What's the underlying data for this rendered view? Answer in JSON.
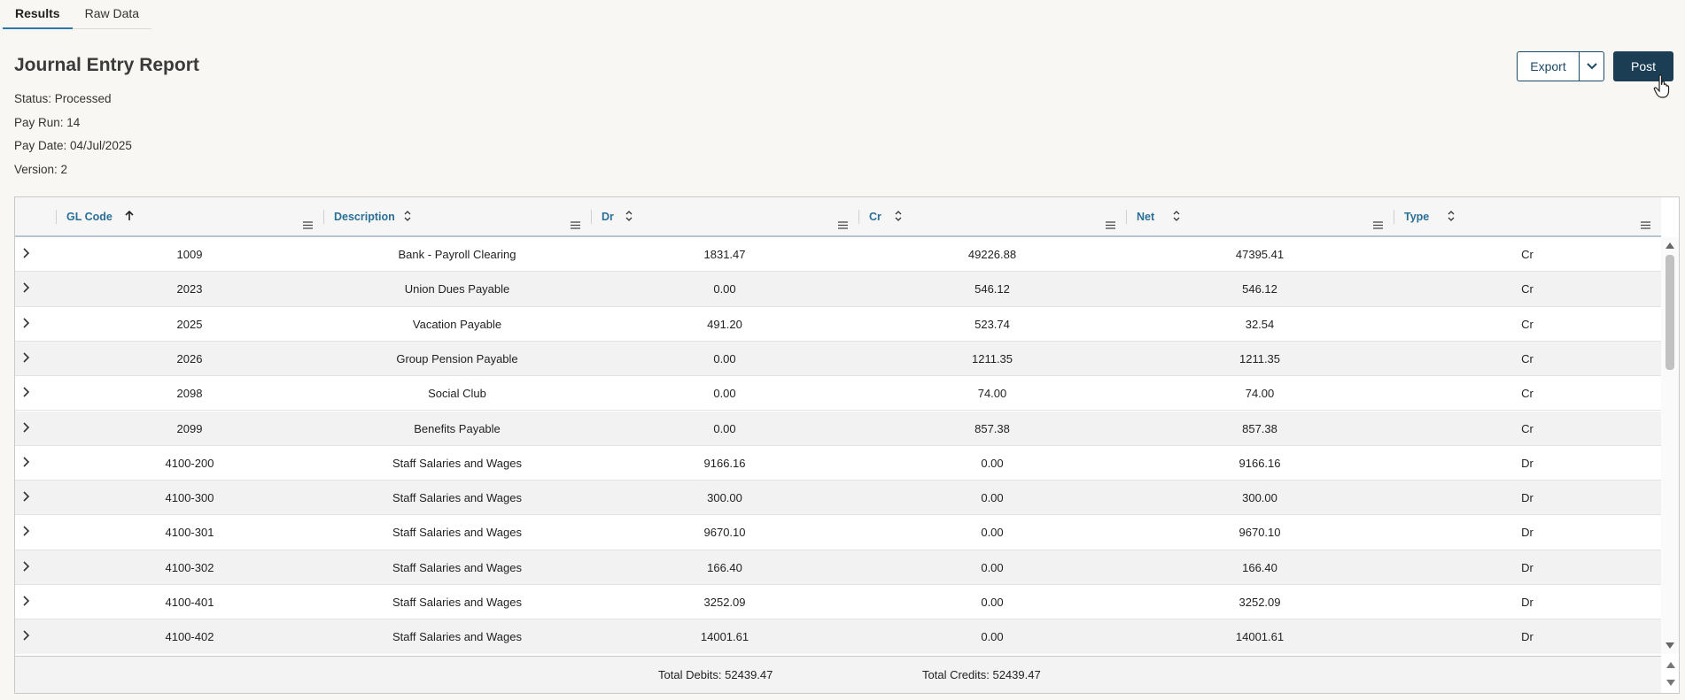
{
  "tabs": [
    {
      "label": "Results",
      "active": true
    },
    {
      "label": "Raw Data",
      "active": false
    }
  ],
  "report": {
    "title": "Journal Entry Report",
    "status": "Status: Processed",
    "pay_run": "Pay Run: 14",
    "pay_date": "Pay Date: 04/Jul/2025",
    "version": "Version: 2"
  },
  "toolbar": {
    "export_label": "Export",
    "post_label": "Post"
  },
  "table": {
    "columns": [
      {
        "label": "GL Code",
        "sort": "asc"
      },
      {
        "label": "Description",
        "sort": "none"
      },
      {
        "label": "Dr",
        "sort": "none"
      },
      {
        "label": "Cr",
        "sort": "none"
      },
      {
        "label": "Net",
        "sort": "none"
      },
      {
        "label": "Type",
        "sort": "none"
      }
    ],
    "rows": [
      [
        "1009",
        "Bank - Payroll Clearing",
        "1831.47",
        "49226.88",
        "47395.41",
        "Cr"
      ],
      [
        "2023",
        "Union Dues Payable",
        "0.00",
        "546.12",
        "546.12",
        "Cr"
      ],
      [
        "2025",
        "Vacation Payable",
        "491.20",
        "523.74",
        "32.54",
        "Cr"
      ],
      [
        "2026",
        "Group Pension Payable",
        "0.00",
        "1211.35",
        "1211.35",
        "Cr"
      ],
      [
        "2098",
        "Social Club",
        "0.00",
        "74.00",
        "74.00",
        "Cr"
      ],
      [
        "2099",
        "Benefits Payable",
        "0.00",
        "857.38",
        "857.38",
        "Cr"
      ],
      [
        "4100-200",
        "Staff Salaries and Wages",
        "9166.16",
        "0.00",
        "9166.16",
        "Dr"
      ],
      [
        "4100-300",
        "Staff Salaries and Wages",
        "300.00",
        "0.00",
        "300.00",
        "Dr"
      ],
      [
        "4100-301",
        "Staff Salaries and Wages",
        "9670.10",
        "0.00",
        "9670.10",
        "Dr"
      ],
      [
        "4100-302",
        "Staff Salaries and Wages",
        "166.40",
        "0.00",
        "166.40",
        "Dr"
      ],
      [
        "4100-401",
        "Staff Salaries and Wages",
        "3252.09",
        "0.00",
        "3252.09",
        "Dr"
      ],
      [
        "4100-402",
        "Staff Salaries and Wages",
        "14001.61",
        "0.00",
        "14001.61",
        "Dr"
      ]
    ],
    "footer": {
      "total_debits": "Total Debits: 52439.47",
      "total_credits": "Total Credits: 52439.47"
    }
  },
  "colors": {
    "primary": "#1b3e55",
    "header_text": "#2a6f96",
    "alt_row": "#f2f2f2",
    "page_bg": "#f8f7f3"
  },
  "icons": {
    "expander": "chevron-right-icon",
    "sort_asc": "arrow-up-icon",
    "sort_none": "sort-both-icon",
    "column_menu": "menu-lines-icon",
    "export_dropdown": "chevron-down-icon"
  }
}
